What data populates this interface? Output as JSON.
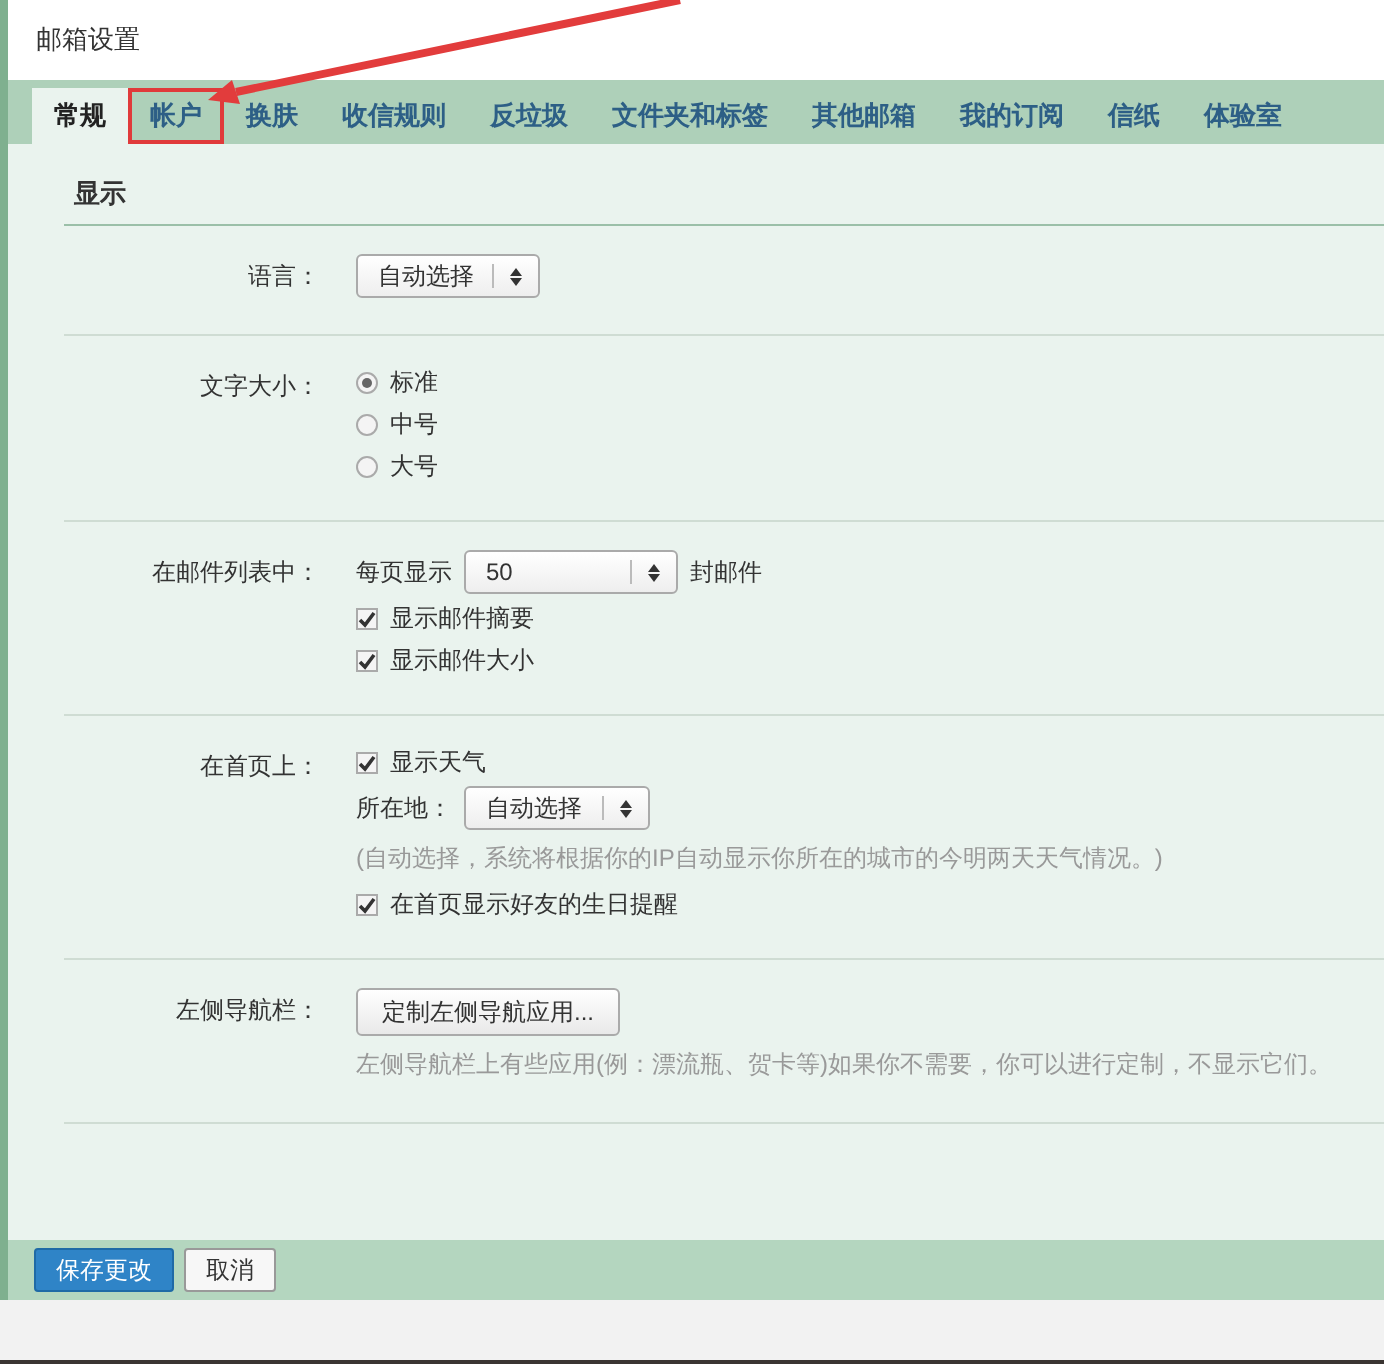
{
  "window": {
    "title": "邮箱设置"
  },
  "tabs": [
    {
      "label": "常规",
      "selected": true,
      "highlighted": false
    },
    {
      "label": "帐户",
      "selected": false,
      "highlighted": true
    },
    {
      "label": "换肤",
      "selected": false,
      "highlighted": false
    },
    {
      "label": "收信规则",
      "selected": false,
      "highlighted": false
    },
    {
      "label": "反垃圾",
      "selected": false,
      "highlighted": false
    },
    {
      "label": "文件夹和标签",
      "selected": false,
      "highlighted": false
    },
    {
      "label": "其他邮箱",
      "selected": false,
      "highlighted": false
    },
    {
      "label": "我的订阅",
      "selected": false,
      "highlighted": false
    },
    {
      "label": "信纸",
      "selected": false,
      "highlighted": false
    },
    {
      "label": "体验室",
      "selected": false,
      "highlighted": false
    }
  ],
  "section": {
    "title": "显示"
  },
  "rows": [
    {
      "label": "语言：",
      "controls": [
        {
          "kind": "select",
          "value": "自动选择"
        }
      ]
    },
    {
      "label": "文字大小：",
      "controls": [
        {
          "kind": "radio",
          "label": "标准",
          "selected": true
        },
        {
          "kind": "radio",
          "label": "中号",
          "selected": false
        },
        {
          "kind": "radio",
          "label": "大号",
          "selected": false
        }
      ]
    },
    {
      "label": "在邮件列表中：",
      "controls": [
        {
          "kind": "select",
          "prefix": "每页显示",
          "value": "50",
          "suffix": "封邮件"
        },
        {
          "kind": "checkbox",
          "label": "显示邮件摘要",
          "checked": true
        },
        {
          "kind": "checkbox",
          "label": "显示邮件大小",
          "checked": true
        }
      ]
    },
    {
      "label": "在首页上：",
      "controls": [
        {
          "kind": "checkbox",
          "label": "显示天气",
          "checked": true
        },
        {
          "kind": "select",
          "prefix": "所在地：",
          "value": "自动选择"
        },
        {
          "kind": "note",
          "text": "(自动选择，系统将根据你的IP自动显示你所在的城市的今明两天天气情况。)"
        },
        {
          "kind": "checkbox",
          "label": "在首页显示好友的生日提醒",
          "checked": true
        }
      ]
    },
    {
      "label": "左侧导航栏：",
      "controls": [
        {
          "kind": "button",
          "label": "定制左侧导航应用..."
        },
        {
          "kind": "note",
          "text": "左侧导航栏上有些应用(例：漂流瓶、贺卡等)如果你不需要，你可以进行定制，不显示它们。"
        }
      ]
    }
  ],
  "footer_buttons": [
    {
      "label": "保存更改",
      "primary": true
    },
    {
      "label": "取消",
      "primary": false
    }
  ]
}
